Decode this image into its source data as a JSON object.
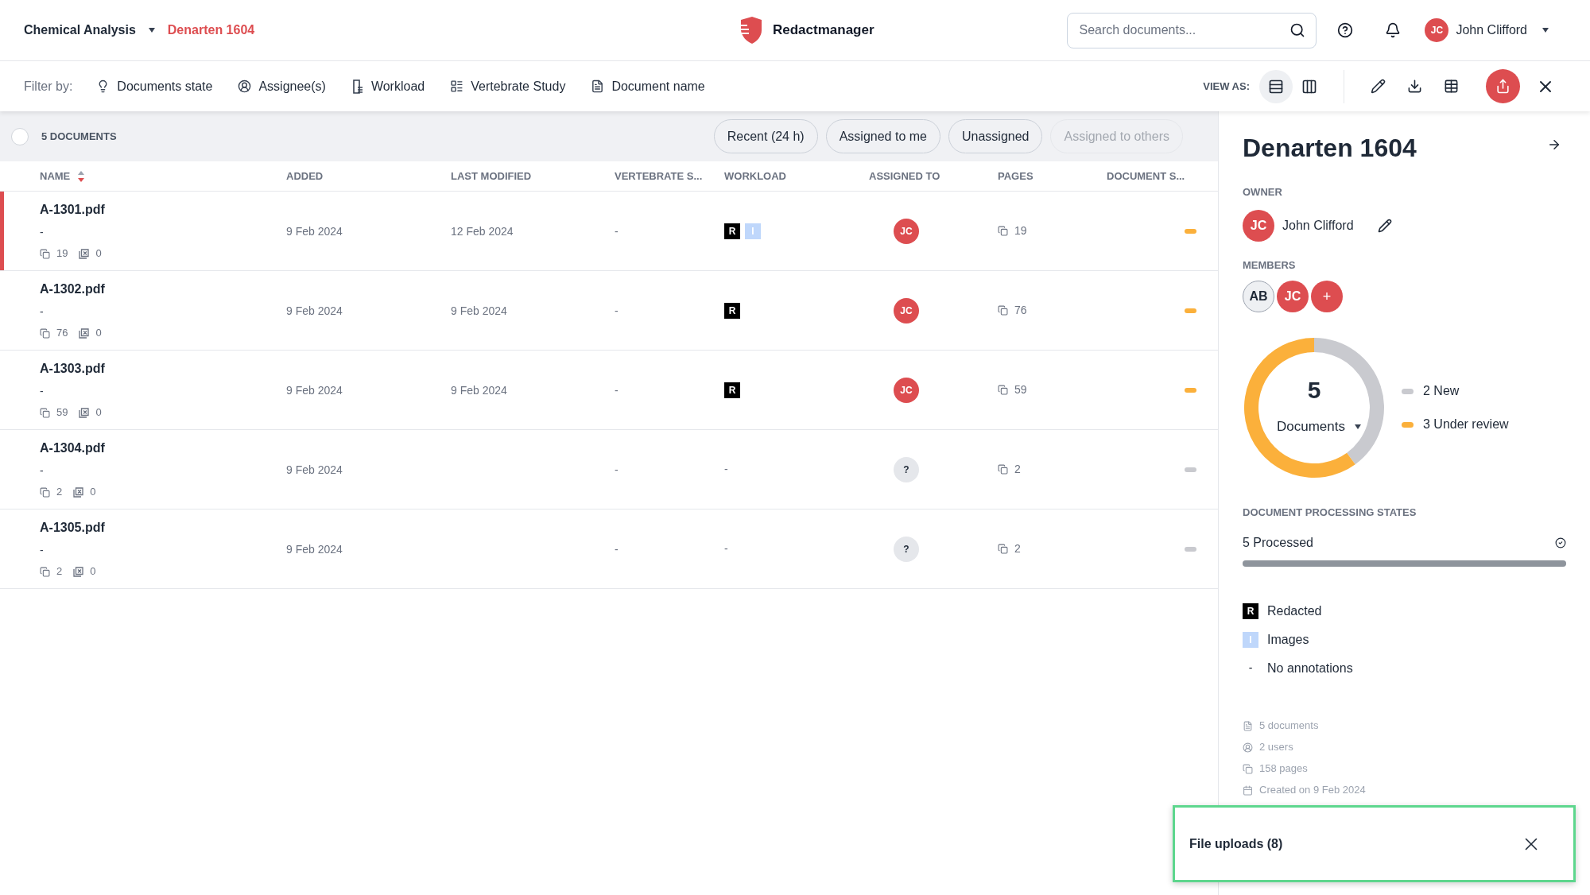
{
  "breadcrumb": [
    {
      "label": "Chemical Analysis",
      "current": false
    },
    {
      "label": "Denarten 1604",
      "current": true
    }
  ],
  "app_name": "Redactmanager",
  "search": {
    "placeholder": "Search documents..."
  },
  "user": {
    "initials": "JC",
    "name": "John Clifford"
  },
  "filter_label": "Filter by:",
  "filters": [
    {
      "label": "Documents state"
    },
    {
      "label": "Assignee(s)"
    },
    {
      "label": "Workload"
    },
    {
      "label": "Vertebrate Study"
    },
    {
      "label": "Document name"
    }
  ],
  "view_as": {
    "label": "VIEW AS:",
    "options": [
      {
        "kind": "list",
        "selected": true
      },
      {
        "kind": "columns",
        "selected": false
      }
    ]
  },
  "select_all": {
    "checked": false
  },
  "documents_count": "5 DOCUMENTS",
  "quick_filters": [
    {
      "label": "Recent (24 h)",
      "disabled": false
    },
    {
      "label": "Assigned to me",
      "disabled": false
    },
    {
      "label": "Unassigned",
      "disabled": false
    },
    {
      "label": "Assigned to others",
      "disabled": true
    }
  ],
  "columns": [
    {
      "label": "NAME",
      "sorted": true
    },
    {
      "label": "ADDED"
    },
    {
      "label": "LAST MODIFIED"
    },
    {
      "label": "VERTEBRATE S..."
    },
    {
      "label": "WORKLOAD"
    },
    {
      "label": "ASSIGNED TO"
    },
    {
      "label": "PAGES"
    },
    {
      "label": "DOCUMENT S..."
    }
  ],
  "rows": [
    {
      "selected": true,
      "name": "A-1301.pdf",
      "subtitle": "-",
      "pages_count": "19",
      "excluded_count": "0",
      "added": "9 Feb 2024",
      "modified": "12 Feb 2024",
      "vertebrate": "-",
      "workload": [
        {
          "kind": "redacted",
          "label": "R"
        },
        {
          "kind": "images",
          "label": "I"
        }
      ],
      "assignee": {
        "kind": "user",
        "initials": "JC"
      },
      "pages": "19",
      "color": "#fbb03b"
    },
    {
      "selected": false,
      "name": "A-1302.pdf",
      "subtitle": "-",
      "pages_count": "76",
      "excluded_count": "0",
      "added": "9 Feb 2024",
      "modified": "9 Feb 2024",
      "vertebrate": "-",
      "workload": [
        {
          "kind": "redacted",
          "label": "R"
        }
      ],
      "assignee": {
        "kind": "user",
        "initials": "JC"
      },
      "pages": "76",
      "color": "#fbb03b"
    },
    {
      "selected": false,
      "name": "A-1303.pdf",
      "subtitle": "-",
      "pages_count": "59",
      "excluded_count": "0",
      "added": "9 Feb 2024",
      "modified": "9 Feb 2024",
      "vertebrate": "-",
      "workload": [
        {
          "kind": "redacted",
          "label": "R"
        }
      ],
      "assignee": {
        "kind": "user",
        "initials": "JC"
      },
      "pages": "59",
      "color": "#fbb03b"
    },
    {
      "selected": false,
      "name": "A-1304.pdf",
      "subtitle": "-",
      "pages_count": "2",
      "excluded_count": "0",
      "added": "9 Feb 2024",
      "vertebrate": "-",
      "workload": "-",
      "assignee": {
        "kind": "unassigned",
        "initials": "?"
      },
      "pages": "2",
      "color": "#c9cacf"
    },
    {
      "selected": false,
      "name": "A-1305.pdf",
      "subtitle": "-",
      "pages_count": "2",
      "excluded_count": "0",
      "added": "9 Feb 2024",
      "vertebrate": "-",
      "workload": "-",
      "assignee": {
        "kind": "unassigned",
        "initials": "?"
      },
      "pages": "2",
      "color": "#c9cacf"
    }
  ],
  "panel": {
    "title": "Denarten 1604",
    "owner_label": "OWNER",
    "owner": {
      "initials": "JC",
      "name": "John Clifford"
    },
    "members_label": "MEMBERS",
    "members": [
      {
        "kind": "guest",
        "initials": "AB"
      },
      {
        "kind": "user",
        "initials": "JC"
      }
    ],
    "add_member": "+",
    "chart_data": {
      "type": "donut",
      "values": [
        40,
        60
      ]
    },
    "legend": [
      {
        "label": "2 New",
        "color": "#c9cacf"
      },
      {
        "label": "3 Under review",
        "color": "#fbb03b"
      }
    ],
    "total": "5",
    "chart_selector": "Documents",
    "processing_label": "DOCUMENT PROCESSING STATES",
    "processing": {
      "label": "5 Processed",
      "level": 1
    },
    "workload_legend": [
      {
        "kind": "redacted",
        "badge": "R",
        "label": "Redacted"
      },
      {
        "kind": "images",
        "badge": "I",
        "label": "Images"
      },
      {
        "kind": "none",
        "badge": "-",
        "label": "No annotations"
      }
    ],
    "stats": [
      {
        "kind": "documents",
        "label": "5 documents"
      },
      {
        "kind": "users",
        "label": "2 users"
      },
      {
        "kind": "pages",
        "label": "158 pages"
      },
      {
        "kind": "created",
        "label": "Created on 9 Feb 2024"
      }
    ]
  },
  "toast": {
    "title": "File uploads (8)"
  }
}
